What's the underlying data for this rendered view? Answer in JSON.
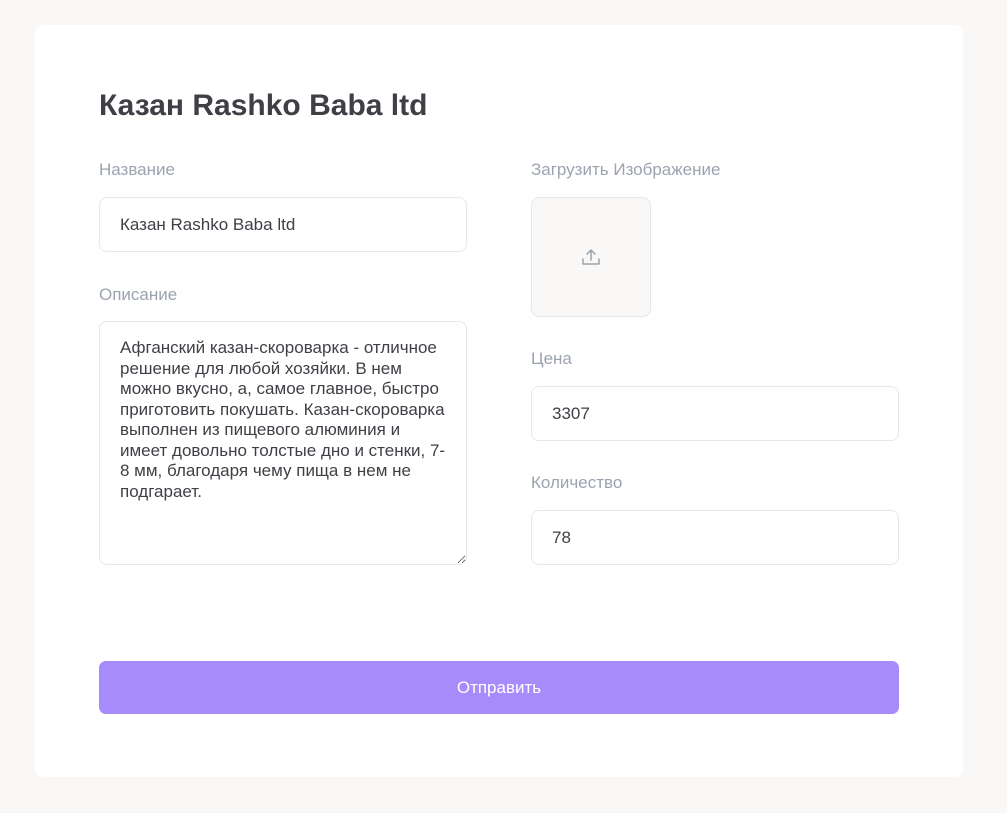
{
  "form": {
    "title": "Казан Rashko Baba ltd",
    "name_label": "Название",
    "name_value": "Казан Rashko Baba ltd",
    "description_label": "Описание",
    "description_value": "Афганский казан-скороварка - отличное решение для любой хозяйки. В нем можно вкусно, а, самое главное, быстро приготовить покушать. Казан-скороварка выполнен из пищевого алюминия и имеет довольно толстые дно и стенки, 7-8 мм, благодаря чему пища в нем не подгарает.",
    "upload_label": "Загрузить Изображение",
    "upload_icon": "upload-icon",
    "price_label": "Цена",
    "price_value": "3307",
    "quantity_label": "Количество",
    "quantity_value": "78",
    "submit_label": "Отправить"
  },
  "colors": {
    "accent": "#a78bfa",
    "background": "#f9f8f6"
  }
}
